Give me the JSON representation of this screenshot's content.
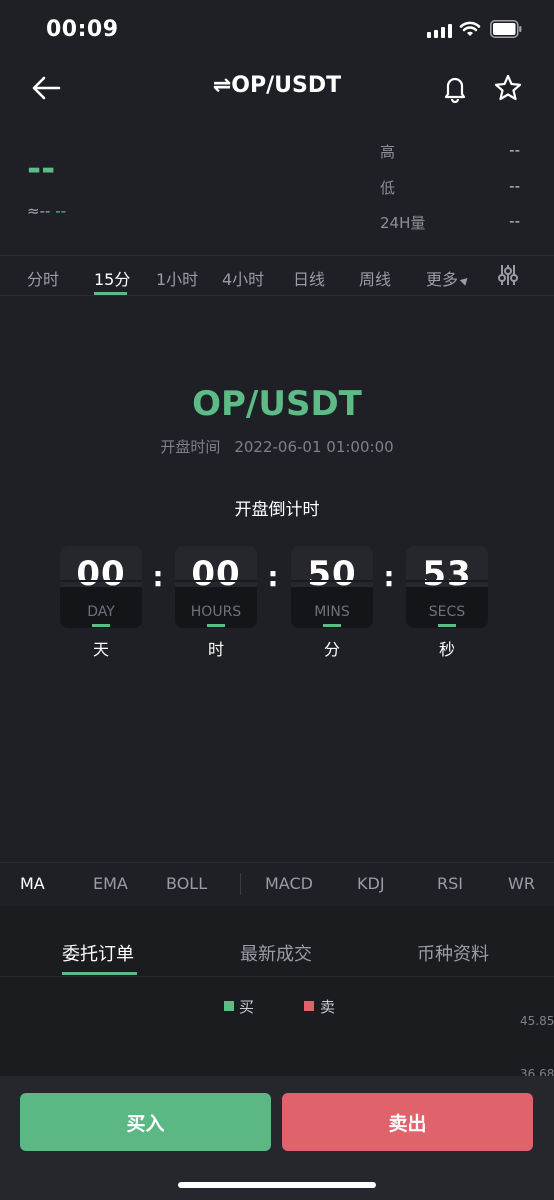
{
  "status": {
    "time": "00:09"
  },
  "header": {
    "title": "⇌OP/USDT"
  },
  "ticker": {
    "price": "--",
    "approx": "≈--",
    "change": "--",
    "stats": [
      {
        "label": "高",
        "value": "--"
      },
      {
        "label": "低",
        "value": "--"
      },
      {
        "label": "24H量",
        "value": "--"
      }
    ]
  },
  "timeframes": [
    "分时",
    "15分",
    "1小时",
    "4小时",
    "日线",
    "周线",
    "更多"
  ],
  "active_timeframe": "15分",
  "countdown": {
    "pair": "OP/USDT",
    "open_label": "开盘时间",
    "open_value": "2022-06-01 01:00:00",
    "title": "开盘倒计时",
    "units": [
      {
        "value": "00",
        "en": "DAY",
        "cn": "天"
      },
      {
        "value": "00",
        "en": "HOURS",
        "cn": "时"
      },
      {
        "value": "50",
        "en": "MINS",
        "cn": "分"
      },
      {
        "value": "53",
        "en": "SECS",
        "cn": "秒"
      }
    ]
  },
  "indicators": [
    "MA",
    "EMA",
    "BOLL",
    "MACD",
    "KDJ",
    "RSI",
    "WR"
  ],
  "order_tabs": [
    "委托订单",
    "最新成交",
    "币种资料"
  ],
  "legend": {
    "buy": "买",
    "sell": "卖",
    "buy_color": "#5dbb86",
    "sell_color": "#e0636b"
  },
  "depth_axis": [
    "45.85",
    "36.68"
  ],
  "actions": {
    "buy": "买入",
    "sell": "卖出"
  }
}
